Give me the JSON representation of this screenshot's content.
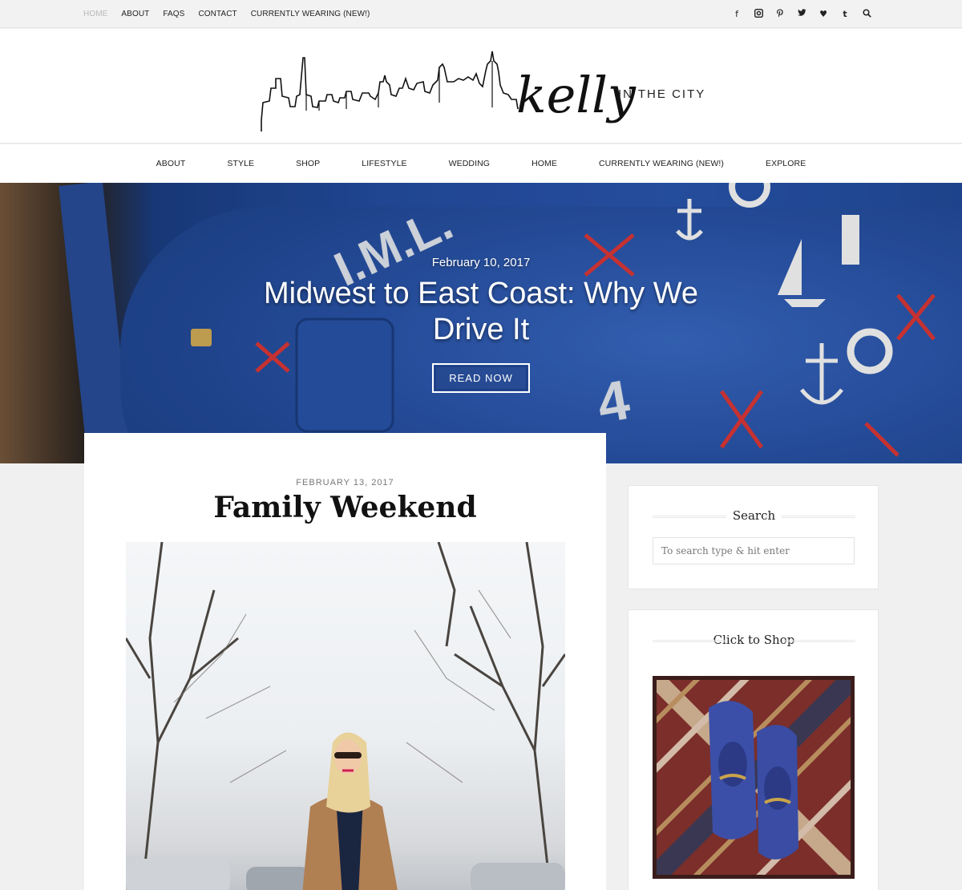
{
  "topbar": {
    "links": [
      "HOME",
      "ABOUT",
      "FAQS",
      "CONTACT",
      "CURRENTLY WEARING (NEW!)"
    ],
    "social_icons": [
      "facebook-icon",
      "instagram-icon",
      "pinterest-icon",
      "twitter-icon",
      "bloglovin-heart-icon",
      "tumblr-icon",
      "search-icon"
    ],
    "social_glyphs": [
      "f",
      "◘",
      "℗",
      "🐦",
      "♥",
      "t",
      "⚲"
    ]
  },
  "logo": {
    "script": "kelly",
    "tagline": "IN THE CITY"
  },
  "mainnav": {
    "items": [
      "ABOUT",
      "STYLE",
      "SHOP",
      "LIFESTYLE",
      "WEDDING",
      "HOME",
      "CURRENTLY WEARING (NEW!)",
      "EXPLORE"
    ]
  },
  "hero": {
    "date": "February 10, 2017",
    "title": "Midwest to East Coast: Why We Drive It",
    "button": "READ NOW"
  },
  "post": {
    "date": "FEBRUARY 13, 2017",
    "title": "Family Weekend"
  },
  "sidebar": {
    "search_title": "Search",
    "search_placeholder": "To search type & hit enter",
    "shop_title": "Click to Shop"
  },
  "colors": {
    "accent_blue": "#2550a6",
    "topbar_bg": "#f2f2f2",
    "page_bg": "#f0f0f0"
  }
}
